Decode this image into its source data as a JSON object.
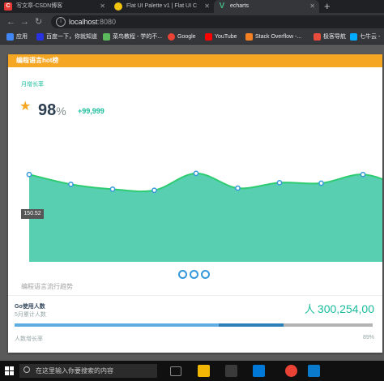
{
  "browser": {
    "tabs": [
      {
        "title": "写文章-CSDN博客",
        "favicon": "csdn-icon",
        "active": false
      },
      {
        "title": "Flat UI Palette v1 | Flat UI C",
        "favicon": "flatui-icon",
        "active": false
      },
      {
        "title": "echarts",
        "favicon": "vue-icon",
        "active": true
      }
    ],
    "address": {
      "host": "localhost",
      "port": ":8080"
    },
    "bookmarks": [
      {
        "label": "应用",
        "icon": "apps-grid-icon",
        "color": "#4285f4"
      },
      {
        "label": "百度一下，你就知道",
        "icon": "baidu-icon",
        "color": "#2932e1"
      },
      {
        "label": "菜鸟教程 - 学的不...",
        "icon": "runoob-icon",
        "color": "#5cb85c"
      },
      {
        "label": "Google",
        "icon": "google-icon",
        "color": "#ea4335"
      },
      {
        "label": "YouTube",
        "icon": "youtube-icon",
        "color": "#ff0000"
      },
      {
        "label": "Stack Overflow -...",
        "icon": "stackoverflow-icon",
        "color": "#f48024"
      },
      {
        "label": "极客导航",
        "icon": "geek-nav-icon",
        "color": "#e74c3c"
      },
      {
        "label": "七牛云 -",
        "icon": "qiniu-icon",
        "color": "#00aaff"
      }
    ]
  },
  "card": {
    "title": "编程语言hot榜",
    "subtitle": "月增长率",
    "star": "★",
    "percent_value": "98",
    "percent_unit": "%",
    "delta": "+99,999",
    "tooltip": "150.52",
    "caption": "编程语言流行趋势",
    "go_title": "Go使用人数",
    "go_subtitle": "5月累计人数",
    "count_unit": "人",
    "count_value": "300,254,00",
    "growth_label": "人数增长率",
    "growth_percent": "89%",
    "progress": {
      "light_fraction": 0.57,
      "dark_fraction": 0.75
    }
  },
  "chart_data": {
    "type": "area",
    "series": [
      {
        "values": [
          160,
          142,
          133,
          131,
          162,
          135,
          145,
          144,
          160,
          138,
          128
        ]
      }
    ],
    "ylim": [
      0,
      190
    ],
    "colors": {
      "fill": "#58cfb0",
      "line": "#2ecc71",
      "marker": "#3498db"
    }
  },
  "carousel": {
    "dots": 3
  },
  "taskbar": {
    "search_placeholder": "在这里输入你要搜索的内容",
    "apps": [
      "task-view-icon",
      "file-explorer-icon",
      "store-icon",
      "mail-icon",
      "chrome-icon",
      "vscode-icon"
    ]
  },
  "colors": {
    "header": "#f5a623",
    "accent": "#1abc9c"
  }
}
